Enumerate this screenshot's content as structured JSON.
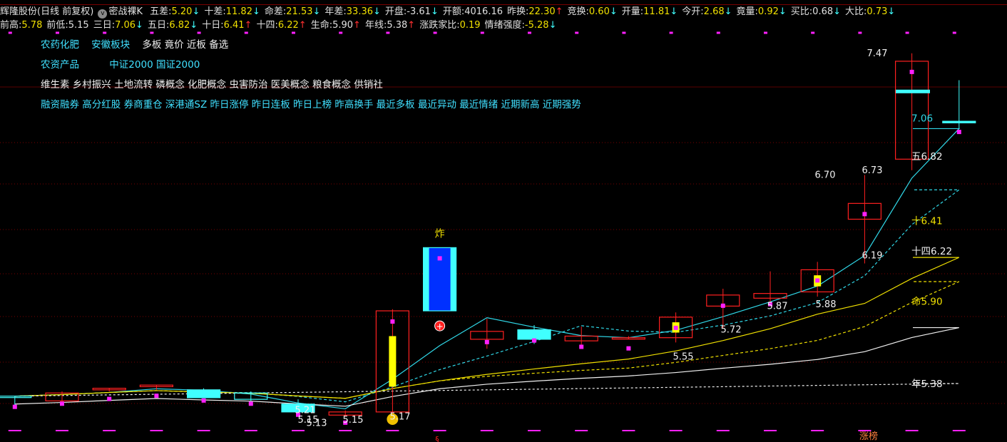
{
  "header": {
    "stock_name": "辉隆股份",
    "period": "(日线 前复权)",
    "indicator": "密战裸K",
    "row1": [
      {
        "label": "五差:",
        "value": "5.20",
        "arrow": "↓",
        "dir": "dn",
        "vc": "y"
      },
      {
        "label": "十差:",
        "value": "11.82",
        "arrow": "↓",
        "dir": "dn",
        "vc": "y"
      },
      {
        "label": "命差:",
        "value": "21.53",
        "arrow": "↓",
        "dir": "dn",
        "vc": "y"
      },
      {
        "label": "年差:",
        "value": "33.36",
        "arrow": "↓",
        "dir": "dn",
        "vc": "y"
      },
      {
        "label": "开盘:",
        "value": "-3.61",
        "arrow": "↓",
        "dir": "dn",
        "vc": "w"
      },
      {
        "label": "开额:",
        "value": "4016.16",
        "arrow": "",
        "dir": "",
        "vc": "w"
      },
      {
        "label": "昨换:",
        "value": "22.30",
        "arrow": "↑",
        "dir": "up",
        "vc": "y"
      },
      {
        "label": "竞换:",
        "value": "0.60",
        "arrow": "↓",
        "dir": "dn",
        "vc": "y"
      },
      {
        "label": "开量:",
        "value": "11.81",
        "arrow": "↓",
        "dir": "dn",
        "vc": "y"
      },
      {
        "label": "今开:",
        "value": "2.68",
        "arrow": "↓",
        "dir": "dn",
        "vc": "y"
      },
      {
        "label": "竟量:",
        "value": "0.92",
        "arrow": "↓",
        "dir": "dn",
        "vc": "y"
      },
      {
        "label": "买比:",
        "value": "0.68",
        "arrow": "↓",
        "dir": "dn",
        "vc": "w"
      },
      {
        "label": "大比:",
        "value": "0.73",
        "arrow": "↓",
        "dir": "dn",
        "vc": "y"
      }
    ],
    "row2": [
      {
        "label": "前高:",
        "value": "5.78",
        "arrow": "",
        "dir": "",
        "vc": "y"
      },
      {
        "label": "前低:",
        "value": "5.15",
        "arrow": "",
        "dir": "",
        "vc": "w"
      },
      {
        "label": "三日:",
        "value": "7.06",
        "arrow": "↓",
        "dir": "dn",
        "vc": "y"
      },
      {
        "label": "五日:",
        "value": "6.82",
        "arrow": "↓",
        "dir": "dn",
        "vc": "y"
      },
      {
        "label": "十日:",
        "value": "6.41",
        "arrow": "↑",
        "dir": "up",
        "vc": "y"
      },
      {
        "label": "十四:",
        "value": "6.22",
        "arrow": "↑",
        "dir": "up",
        "vc": "y"
      },
      {
        "label": "生命:",
        "value": "5.90",
        "arrow": "↑",
        "dir": "up",
        "vc": "w"
      },
      {
        "label": "年线:",
        "value": "5.38",
        "arrow": "↑",
        "dir": "up",
        "vc": "w"
      },
      {
        "label": "涨跌家比:",
        "value": "0.19",
        "arrow": "",
        "dir": "",
        "vc": "y"
      },
      {
        "label": "情绪强度:",
        "value": "-5.28",
        "arrow": "↓",
        "dir": "dn",
        "vc": "y"
      }
    ]
  },
  "tags": {
    "row1": [
      "农药化肥",
      "安徽板块"
    ],
    "row1_extra": "多板 竟价 近板 备选",
    "row2": "农资产品",
    "row2_extra": "中证2000 国证2000",
    "row3": "维生素 乡村振兴 土地流转 磷概念 化肥概念 虫害防治 医美概念 粮食概念 供销社",
    "row4": "融资融券 高分红股 券商重仓 深港通SZ 昨日涨停 昨日连板 昨日上榜 昨高换手 最近多板 最近异动 最近情绪 近期新高 近期强势"
  },
  "colors": {
    "up": "#ff2020",
    "down": "#40ffff",
    "blue_fill": "#0030ff",
    "ma3": "#30d8e8",
    "ma5": "#30d8e8",
    "ma10": "#f0e000",
    "ma14": "#f0e000",
    "life": "#f0f0f0",
    "year": "#f0f0f0",
    "magenta": "#ff20ff",
    "yellow": "#ffff00",
    "grid": "#7a0000"
  },
  "chart_data": {
    "type": "candlestick",
    "price_range": [
      5.1,
      7.6
    ],
    "candles": [
      {
        "o": 5.3,
        "h": 5.3,
        "l": 5.24,
        "c": 5.3,
        "color": "cyan-line"
      },
      {
        "o": 5.27,
        "h": 5.33,
        "l": 5.25,
        "c": 5.32,
        "color": "red"
      },
      {
        "o": 5.34,
        "h": 5.35,
        "l": 5.33,
        "c": 5.35,
        "color": "red"
      },
      {
        "o": 5.36,
        "h": 5.37,
        "l": 5.34,
        "c": 5.37,
        "color": "red"
      },
      {
        "o": 5.34,
        "h": 5.35,
        "l": 5.29,
        "c": 5.29,
        "color": "cyan"
      },
      {
        "o": 5.32,
        "h": 5.33,
        "l": 5.27,
        "c": 5.28,
        "color": "cyan-line"
      },
      {
        "o": 5.25,
        "h": 5.28,
        "l": 5.2,
        "c": 5.2,
        "color": "cyan"
      },
      {
        "o": 5.2,
        "h": 5.21,
        "l": 5.17,
        "c": 5.18,
        "color": "red-line"
      },
      {
        "o": 5.2,
        "h": 5.85,
        "l": 5.15,
        "c": 5.84,
        "color": "red",
        "vol_bar": true
      },
      {
        "o": 6.24,
        "h": 6.24,
        "l": 5.84,
        "c": 5.84,
        "color": "blue"
      },
      {
        "o": 5.66,
        "h": 5.79,
        "l": 5.6,
        "c": 5.71,
        "color": "red"
      },
      {
        "o": 5.72,
        "h": 5.75,
        "l": 5.63,
        "c": 5.66,
        "color": "cyan"
      },
      {
        "o": 5.65,
        "h": 5.74,
        "l": 5.62,
        "c": 5.68,
        "color": "red"
      },
      {
        "o": 5.67,
        "h": 5.68,
        "l": 5.66,
        "c": 5.67,
        "color": "red-line"
      },
      {
        "o": 5.67,
        "h": 5.83,
        "l": 5.64,
        "c": 5.8,
        "color": "red",
        "vol_bar": true
      },
      {
        "o": 5.87,
        "h": 5.98,
        "l": 5.73,
        "c": 5.94,
        "color": "red"
      },
      {
        "o": 5.92,
        "h": 6.09,
        "l": 5.88,
        "c": 5.95,
        "color": "red"
      },
      {
        "o": 5.96,
        "h": 6.15,
        "l": 5.93,
        "c": 6.1,
        "color": "red",
        "vol_bar": true
      },
      {
        "o": 6.42,
        "h": 6.7,
        "l": 6.14,
        "c": 6.52,
        "color": "red"
      },
      {
        "o": 6.8,
        "h": 7.47,
        "l": 6.73,
        "c": 7.42,
        "color": "red"
      },
      {
        "o": 7.03,
        "h": 7.3,
        "l": 6.99,
        "c": 7.04,
        "color": "cyan"
      }
    ],
    "ma_labels": {
      "ma3": {
        "prefix": "",
        "value": "7.06"
      },
      "ma5": {
        "prefix": "五",
        "value": "6.82"
      },
      "ma10": {
        "prefix": "十",
        "value": "6.41"
      },
      "ma14": {
        "prefix": "十四",
        "value": "6.22"
      },
      "life": {
        "prefix": "命",
        "value": "5.90"
      },
      "year": {
        "prefix": "年",
        "value": "5.38"
      }
    },
    "annotations": [
      "7.47",
      "6.73",
      "6.70",
      "6.19",
      "5.87",
      "5.88",
      "5.72",
      "5.55",
      "5.21",
      "5.15",
      "5.13",
      "5.15",
      "5.17"
    ],
    "markers": [
      "炸",
      "涨榜",
      "§"
    ]
  }
}
